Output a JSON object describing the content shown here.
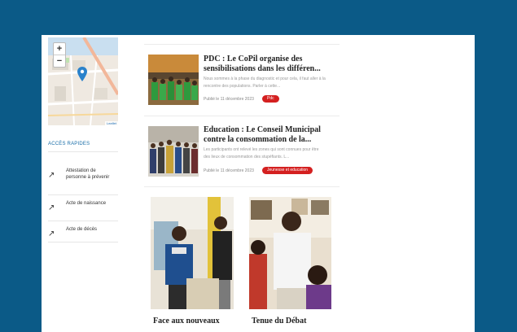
{
  "map": {
    "zoom_in": "+",
    "zoom_out": "−",
    "attribution": "Leaflet"
  },
  "quick_access": {
    "title": "ACCÈS RAPIDES",
    "items": [
      {
        "label": "Attestation de personne à prévenir"
      },
      {
        "label": "Acte de naissance"
      },
      {
        "label": "Acte de décès"
      }
    ]
  },
  "articles": [
    {
      "title": "PDC : Le CoPil organise des sensibilisations dans les différen...",
      "excerpt": "Nous sommes à la phase du diagnostic et pour cela, il faut aller à la rencontre des populations. Parler à cette...",
      "date": "Publié le 11 décembre 2023",
      "tag": "Pdc"
    },
    {
      "title": "Education : Le Conseil Municipal contre la consommation de la...",
      "excerpt": "Les participants ont relevé les zones qui sont connues pour être des lieux de consommation des stupéfiants. L...",
      "date": "Publié le 11 décembre 2023",
      "tag": "Jeunesse et education"
    }
  ],
  "cards": [
    {
      "title": "Face aux nouveaux"
    },
    {
      "title": "Tenue du Débat"
    }
  ],
  "colors": {
    "background": "#0b5a87",
    "badge": "#d42020",
    "accent": "#1a6ea8"
  }
}
